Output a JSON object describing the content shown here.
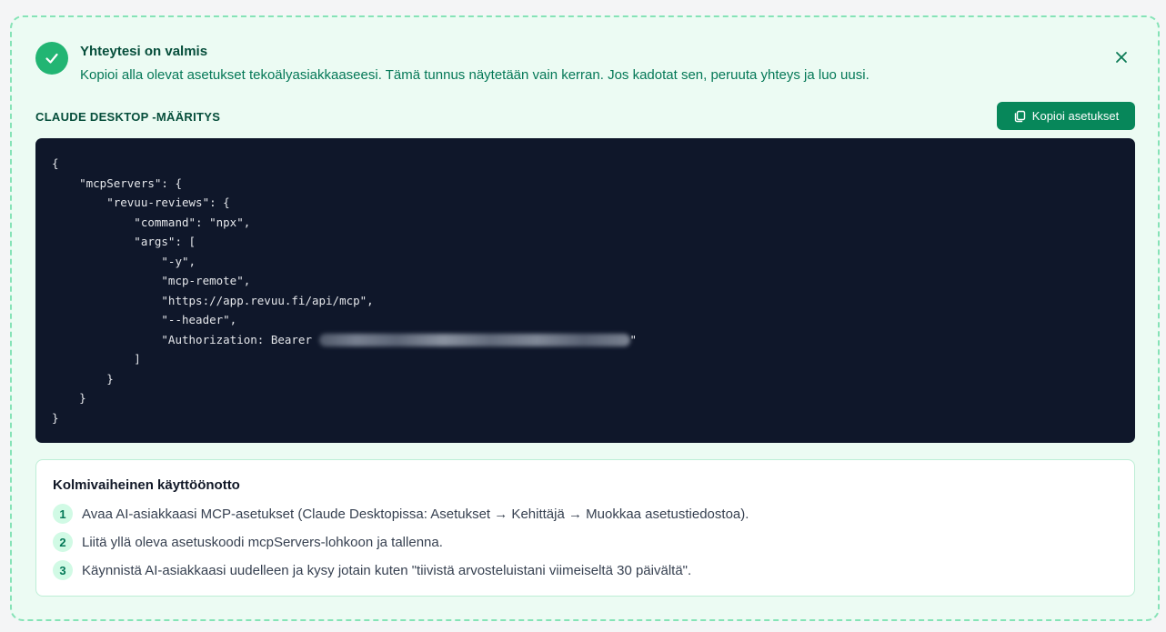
{
  "banner": {
    "title": "Yhteytesi on valmis",
    "subtitle": "Kopioi alla olevat asetukset tekoälyasiakkaaseesi. Tämä tunnus näytetään vain kerran. Jos kadotat sen, peruuta yhteys ja luo uusi.",
    "close_icon": "close-icon",
    "status_icon": "check-icon"
  },
  "config": {
    "label": "CLAUDE DESKTOP -MÄÄRITYS",
    "copy_button_label": "Kopioi asetukset",
    "copy_icon": "copy-icon",
    "code_lines": [
      "{",
      "    \"mcpServers\": {",
      "        \"revuu-reviews\": {",
      "            \"command\": \"npx\",",
      "            \"args\": [",
      "                \"-y\",",
      "                \"mcp-remote\",",
      "                \"https://app.revuu.fi/api/mcp\",",
      "                \"--header\",",
      "                \"Authorization: Bearer ",
      "            ]",
      "        }",
      "    }",
      "}"
    ],
    "token_suffix": "\""
  },
  "steps": {
    "title": "Kolmivaiheinen käyttöönotto",
    "items": [
      {
        "number": "1",
        "text": "Avaa AI-asiakkaasi MCP-asetukset (Claude Desktopissa: Asetukset → Kehittäjä → Muokkaa asetustiedostoa)."
      },
      {
        "number": "2",
        "text": "Liitä yllä oleva asetuskoodi mcpServers-lohkoon ja tallenna."
      },
      {
        "number": "3",
        "text": "Käynnistä AI-asiakkaasi uudelleen ja kysy jotain kuten \"tiivistä arvosteluistani viimeiseltä 30 päivältä\"."
      }
    ]
  },
  "colors": {
    "accent": "#07875a",
    "success": "#22b573",
    "panel_bg": "#ecfbf3",
    "code_bg": "#0f172a"
  }
}
